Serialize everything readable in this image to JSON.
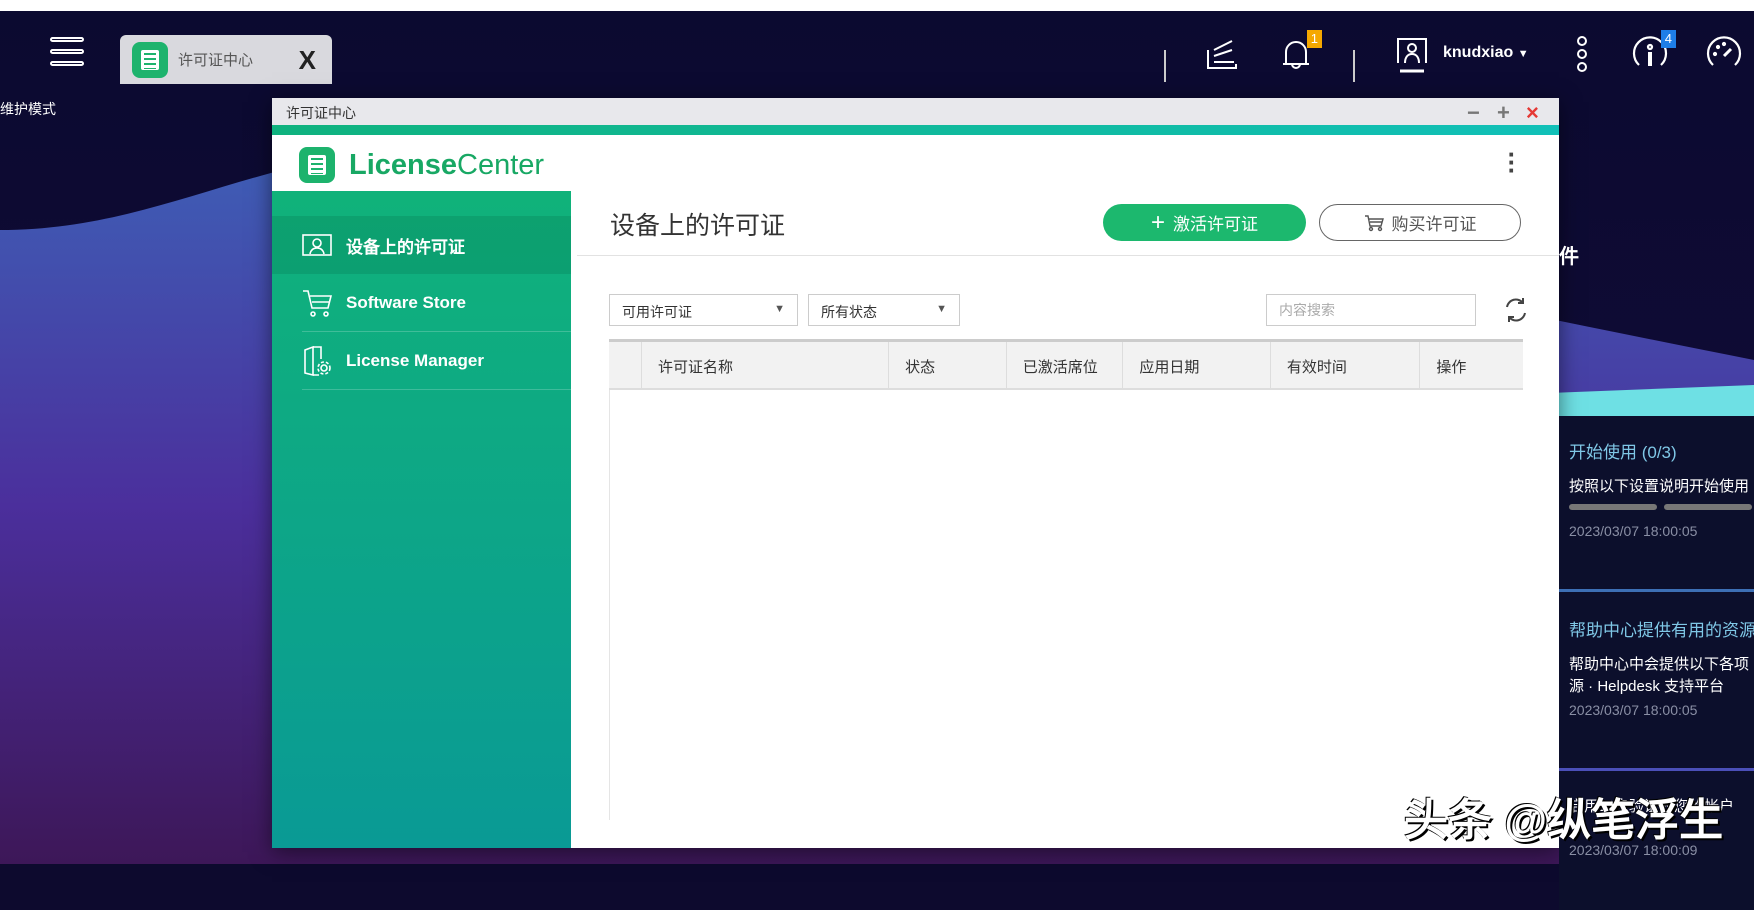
{
  "desktop": {
    "maintenance_mode": "维护模式",
    "taskbar_tab": {
      "label": "许可证中心",
      "close": "X"
    },
    "username": "knudxiao",
    "notification_badge": "1",
    "info_badge": "4",
    "icons": [
      "menu-icon",
      "tasks-icon",
      "bell-icon",
      "user-icon",
      "more-icon",
      "info-icon",
      "dashboard-icon"
    ]
  },
  "window": {
    "title": "许可证中心",
    "controls": {
      "minimize": "−",
      "maximize": "+",
      "close": "×"
    },
    "logo": {
      "bold": "License",
      "light": "Center"
    },
    "accent": "#1cb86e"
  },
  "sidebar": {
    "items": [
      {
        "label": "设备上的许可证",
        "icon": "license-card-icon",
        "selected": true
      },
      {
        "label": "Software Store",
        "icon": "cart-icon",
        "selected": false
      },
      {
        "label": "License Manager",
        "icon": "license-manager-icon",
        "selected": false
      }
    ]
  },
  "main": {
    "title": "设备上的许可证",
    "activate_label": "激活许可证",
    "buy_label": "购买许可证",
    "filter_type": "可用许可证",
    "filter_status": "所有状态",
    "search_placeholder": "内容搜索",
    "columns": [
      "许可证名称",
      "状态",
      "已激活席位",
      "应用日期",
      "有效时间",
      "操作"
    ],
    "rows": []
  },
  "right_panel": {
    "partial_heading": "件",
    "items": [
      {
        "title": "开始使用 (0/3)",
        "text": [
          "按照以下设置说明开始使用"
        ],
        "time": "2023/03/07 18:00:05"
      },
      {
        "title": "帮助中心提供有用的资源",
        "text": [
          "帮助中心中会提供以下各项",
          "源 · Helpdesk 支持平台"
        ],
        "time": "2023/03/07 18:00:05"
      },
      {
        "title": "",
        "text": [
          "启用二步验证为您的帐户"
        ],
        "time": "2023/03/07 18:00:09"
      }
    ]
  },
  "watermark": "头条 @纵笔浮生"
}
